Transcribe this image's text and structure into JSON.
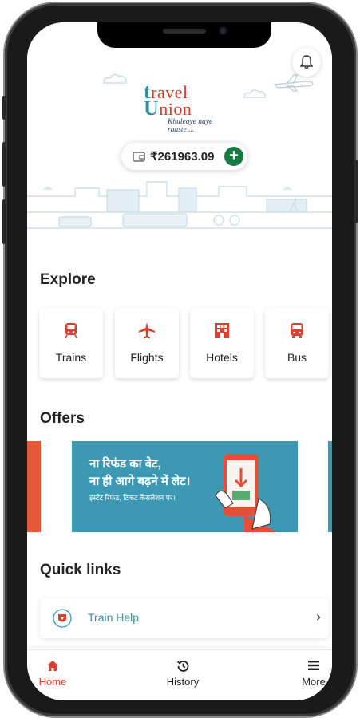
{
  "app": {
    "brand_top": "ravel",
    "brand_t": "t",
    "brand_bottom": "nion",
    "brand_u": "U",
    "tagline": "Khuleaye naye raaste ..."
  },
  "wallet": {
    "amount": "₹261963.09",
    "add_symbol": "+"
  },
  "explore": {
    "title": "Explore",
    "items": [
      {
        "label": "Trains",
        "icon": "train-icon"
      },
      {
        "label": "Flights",
        "icon": "flight-icon"
      },
      {
        "label": "Hotels",
        "icon": "hotel-icon"
      },
      {
        "label": "Bus",
        "icon": "bus-icon"
      }
    ]
  },
  "offers": {
    "title": "Offers",
    "banner": {
      "line1": "ना रिफंड का वेट,",
      "line2": "ना ही आगे बढ़ने में लेट।",
      "sub": "इंस्टेंट रिफंड, टिकट कैंसलेशन पर।"
    }
  },
  "quick_links": {
    "title": "Quick links",
    "items": [
      {
        "label": "Train Help",
        "chevron": "›"
      }
    ]
  },
  "nav": {
    "items": [
      {
        "label": "Home",
        "icon": "home-icon",
        "active": true
      },
      {
        "label": "History",
        "icon": "history-icon",
        "active": false
      },
      {
        "label": "More",
        "icon": "menu-icon",
        "active": false
      }
    ]
  },
  "colors": {
    "accent": "#d9402e",
    "teal": "#3d98b3",
    "green": "#177a42",
    "offer_bg": "#3d98b3"
  }
}
